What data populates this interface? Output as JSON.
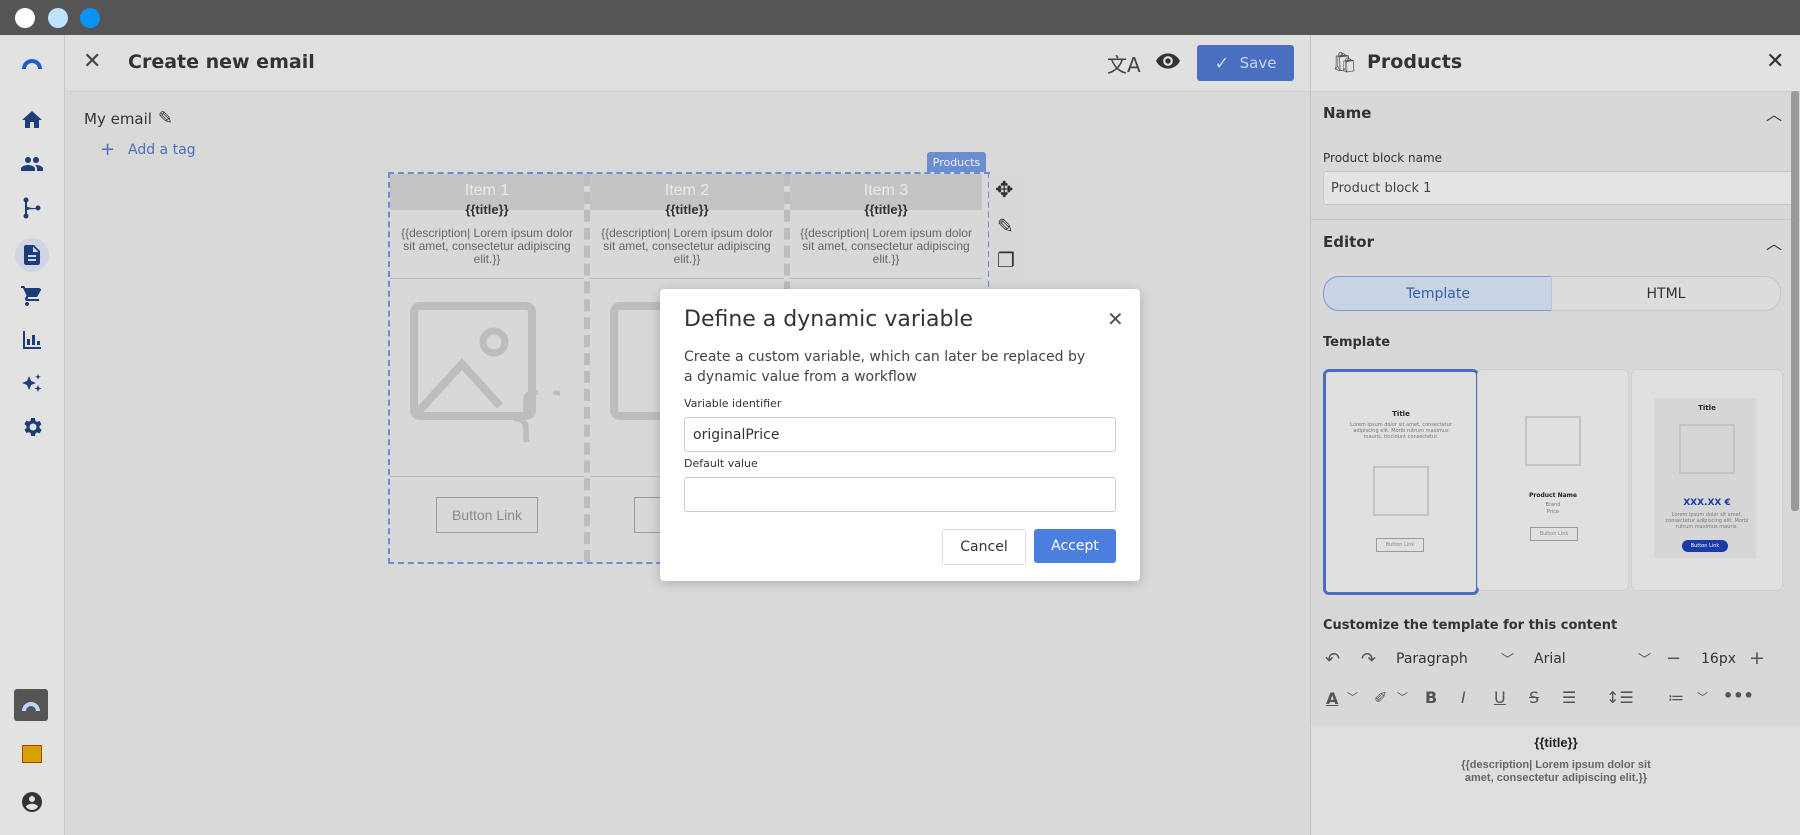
{
  "header": {
    "title": "Create new email",
    "save_label": "Save"
  },
  "email": {
    "name": "My email",
    "add_tag_label": "Add a tag",
    "block_badge": "Products",
    "items": [
      {
        "label": "Item 1",
        "title": "{{title}}",
        "description": "{{description| Lorem ipsum dolor sit amet, consectetur adipiscing elit.}}",
        "button": "Button Link"
      },
      {
        "label": "Item 2",
        "title": "{{title}}",
        "description": "{{description| Lorem ipsum dolor sit amet, consectetur adipiscing elit.}}",
        "button": "B"
      },
      {
        "label": "Item 3",
        "title": "{{title}}",
        "description": "{{description| Lorem ipsum dolor sit amet, consectetur adipiscing elit.}}",
        "button": ""
      }
    ]
  },
  "panel": {
    "title": "Products",
    "name_section": "Name",
    "block_name_label": "Product block name",
    "block_name_value": "Product block 1",
    "editor_section": "Editor",
    "tab_template": "Template",
    "tab_html": "HTML",
    "template_label": "Template",
    "templates": [
      {
        "title": "Title",
        "text": "Lorem ipsum dolor sit amet, consectetur adipiscing elit. Morbi rutrum maximus mauris, tincidunt consectetur.",
        "button": "Button Link"
      },
      {
        "name": "Product Name",
        "line1": "Brand",
        "line2": "Price",
        "button": "Button Link"
      },
      {
        "title": "Title",
        "price": "XXX.XX €",
        "text": "Lorem ipsum dolor sit amet, consectetur adipiscing elit. Morbi rutrum maximus mauris.",
        "button": "Button Link"
      }
    ],
    "customize_label": "Customize the template for this content",
    "paragraph_select": "Paragraph",
    "font_select": "Arial",
    "font_size": "16px",
    "preview_title": "{{title}}",
    "preview_desc": "{{description| Lorem ipsum dolor sit amet, consectetur adipiscing elit.}}"
  },
  "modal": {
    "title": "Define a dynamic variable",
    "description": "Create a custom variable, which can later be replaced by a dynamic value from a workflow",
    "identifier_label": "Variable identifier",
    "identifier_value": "originalPrice",
    "default_label": "Default value",
    "default_value": "",
    "cancel_label": "Cancel",
    "accept_label": "Accept"
  },
  "colors": {
    "accent": "#4a7fe0",
    "nav_icon": "#1c3d78",
    "mac_dots": [
      "#ffffff",
      "#bfe4ff",
      "#0a93f5"
    ]
  }
}
